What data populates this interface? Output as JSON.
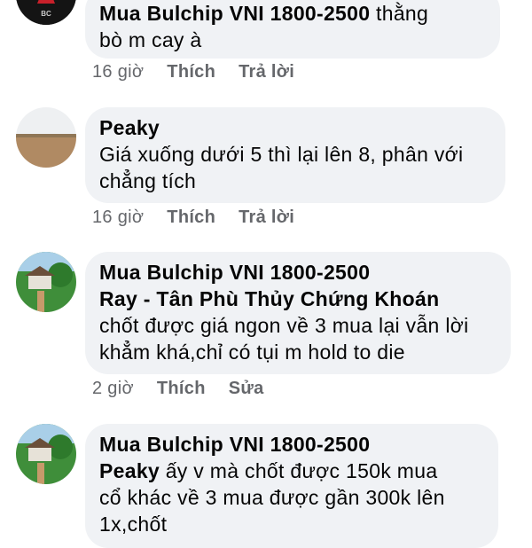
{
  "comments": [
    {
      "lines": [
        {
          "name": "Mua Bulchip VNI 1800-2500",
          "text": " thằng"
        },
        {
          "name": "",
          "text": "bò m cay à"
        }
      ],
      "time": "16 giờ",
      "like": "Thích",
      "action": "Trả lời"
    },
    {
      "lines": [
        {
          "name": "Peaky",
          "text": ""
        },
        {
          "name": "",
          "text": "Giá xuống dưới 5 thì lại lên 8, phân với"
        },
        {
          "name": "",
          "text": "chẳng tích"
        }
      ],
      "time": "16 giờ",
      "like": "Thích",
      "action": "Trả lời"
    },
    {
      "lines": [
        {
          "name": "Mua Bulchip VNI 1800-2500",
          "text": ""
        },
        {
          "name": "Ray - Tân Phù Thủy Chứng Khoán",
          "text": ""
        },
        {
          "name": "",
          "text": "chốt được giá ngon về 3 mua lại vẫn lời"
        },
        {
          "name": "",
          "text": "khẳm khá,chỉ có tụi m hold to die"
        }
      ],
      "time": "2 giờ",
      "like": "Thích",
      "action": "Sửa"
    },
    {
      "lines": [
        {
          "name": "Mua Bulchip VNI 1800-2500",
          "text": ""
        },
        {
          "name": "Peaky",
          "text": " ấy v mà chốt được 150k mua"
        },
        {
          "name": "",
          "text": "cổ khác về 3 mua được gần 300k lên"
        },
        {
          "name": "",
          "text": "1x,chốt"
        }
      ]
    }
  ],
  "avatar_logo_text": "BC"
}
